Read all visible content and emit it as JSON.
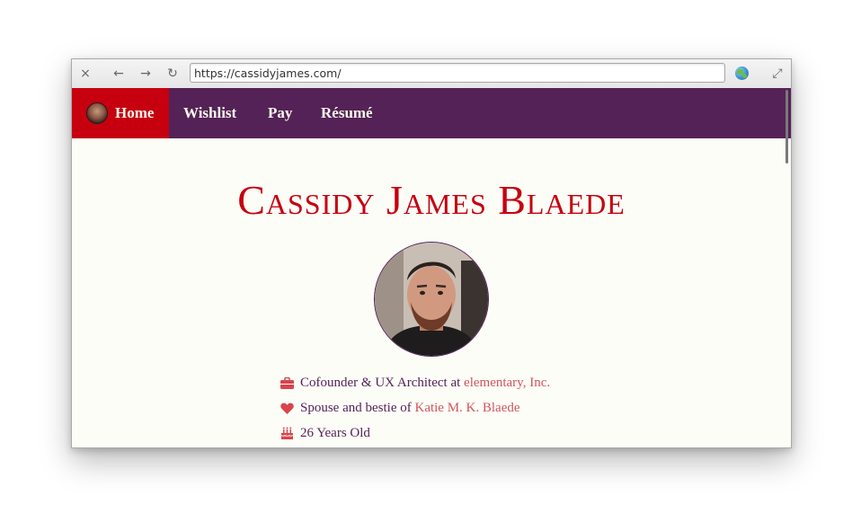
{
  "browser": {
    "url": "https://cassidyjames.com/",
    "close_icon": "×",
    "back_icon": "←",
    "forward_icon": "→",
    "reload_icon": "↻",
    "fullscreen_icon": "⤢"
  },
  "nav": {
    "items": [
      {
        "label": "Home"
      },
      {
        "label": "Wishlist"
      },
      {
        "label": "Pay"
      },
      {
        "label": "Résumé"
      }
    ]
  },
  "profile": {
    "name": "Cassidy James Blaede",
    "facts": [
      {
        "text": "Cofounder & UX Architect at ",
        "link": "elementary, Inc.",
        "icon": "briefcase-icon"
      },
      {
        "text": "Spouse and bestie of ",
        "link": "Katie M. K. Blaede",
        "icon": "heart-icon"
      },
      {
        "text": "26 Years Old",
        "link": "",
        "icon": "birthday-cake-icon"
      }
    ]
  },
  "colors": {
    "nav_background": "#542257",
    "home_background": "#c6000f",
    "title": "#c6000f",
    "link": "#d0555b",
    "icon": "#d9444c",
    "text": "#542257"
  }
}
